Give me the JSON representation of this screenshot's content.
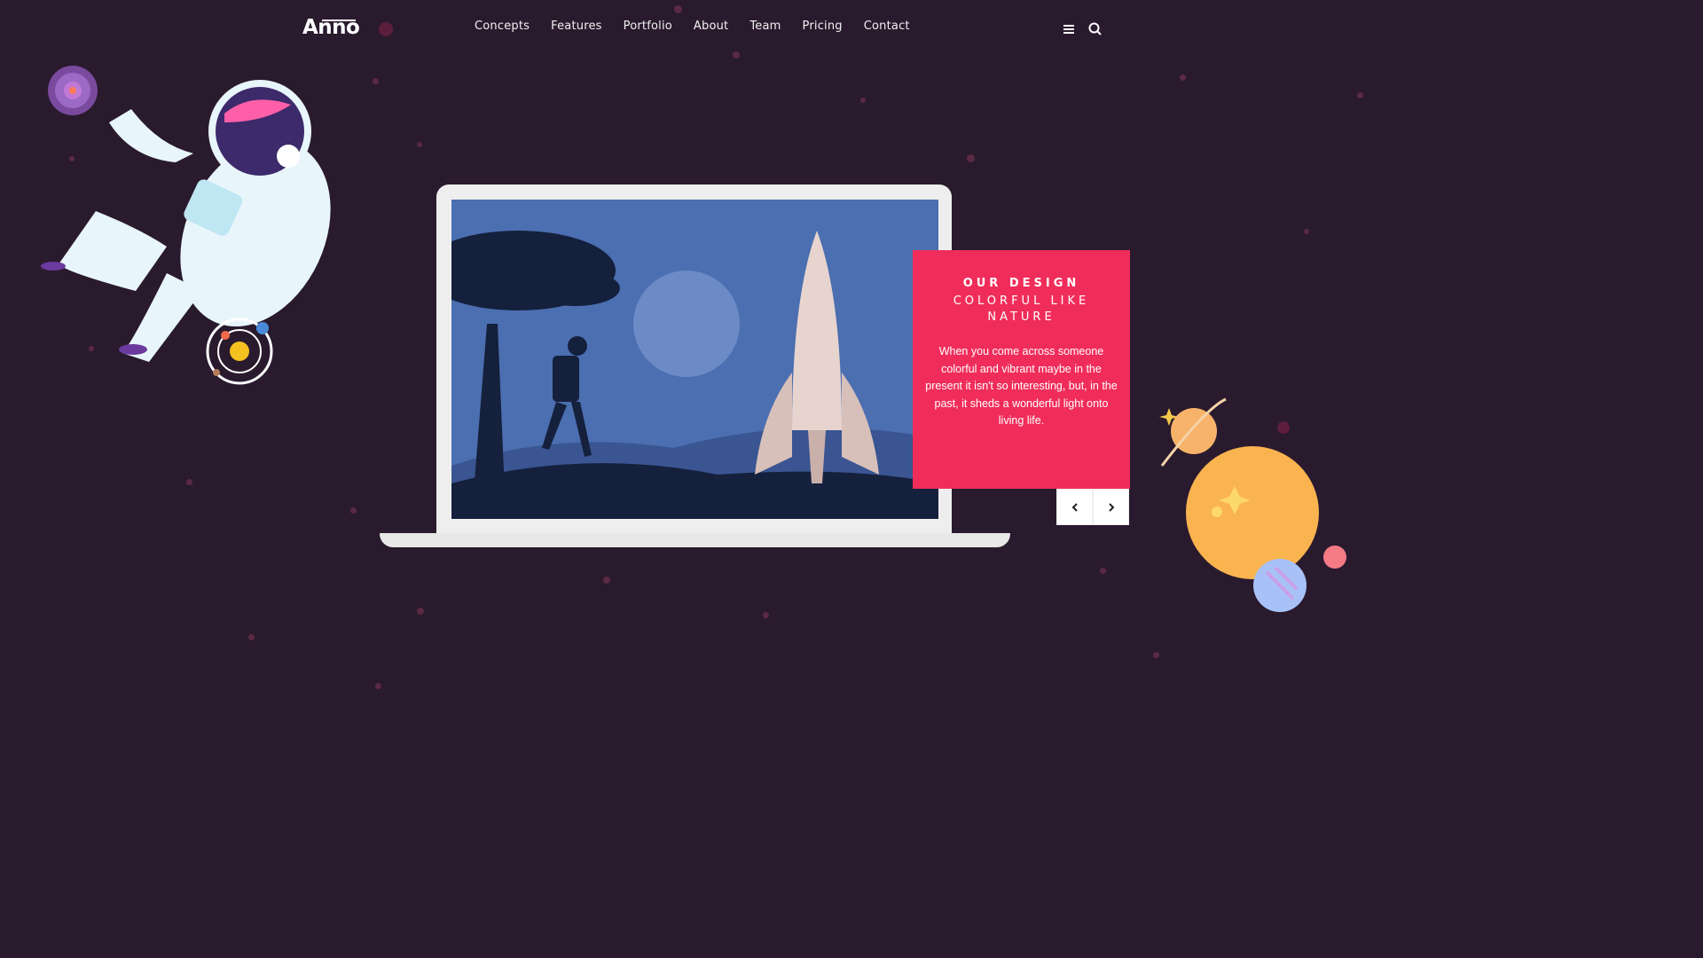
{
  "brand": {
    "logo": "Anno"
  },
  "nav": {
    "items": [
      "Concepts",
      "Features",
      "Portfolio",
      "About",
      "Team",
      "Pricing",
      "Contact"
    ],
    "icons": [
      "menu-icon",
      "search-icon"
    ]
  },
  "slider": {
    "title": "OUR DESIGN",
    "subtitle": "COLORFUL LIKE NATURE",
    "text": "When you come across someone colorful and vibrant maybe in the present it isn't so interesting, but, in the past, it sheds a wonderful light onto living life.",
    "prev_icon": "chevron-left-icon",
    "next_icon": "chevron-right-icon"
  },
  "colors": {
    "background": "#2a1a2e",
    "accent": "#f02d5a",
    "screen_sky": "#4b6fb0"
  }
}
